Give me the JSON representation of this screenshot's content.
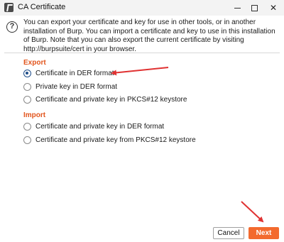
{
  "window": {
    "title": "CA Certificate",
    "icon": "burp-icon"
  },
  "controls": {
    "minimize": "minimize-icon",
    "maximize": "maximize-icon",
    "close": "✕"
  },
  "info": {
    "icon_glyph": "?",
    "text": "You can export your certificate and key for use in other tools, or in another installation of Burp. You can import a certificate and key to use in this installation of Burp. Note that you can also export the current certificate by visiting http://burpsuite/cert in your browser."
  },
  "export": {
    "title": "Export",
    "options": [
      {
        "label": "Certificate in DER format",
        "selected": true
      },
      {
        "label": "Private key in DER format",
        "selected": false
      },
      {
        "label": "Certificate and private key in PKCS#12 keystore",
        "selected": false
      }
    ]
  },
  "import": {
    "title": "Import",
    "options": [
      {
        "label": "Certificate and private key in DER format",
        "selected": false
      },
      {
        "label": "Certificate and private key from PKCS#12 keystore",
        "selected": false
      }
    ]
  },
  "buttons": {
    "cancel": "Cancel",
    "next": "Next"
  },
  "colors": {
    "accent": "#e2551d",
    "next_button": "#f36a2e",
    "annotation_arrow": "#e03232",
    "radio_selected": "#1f4e8a"
  }
}
